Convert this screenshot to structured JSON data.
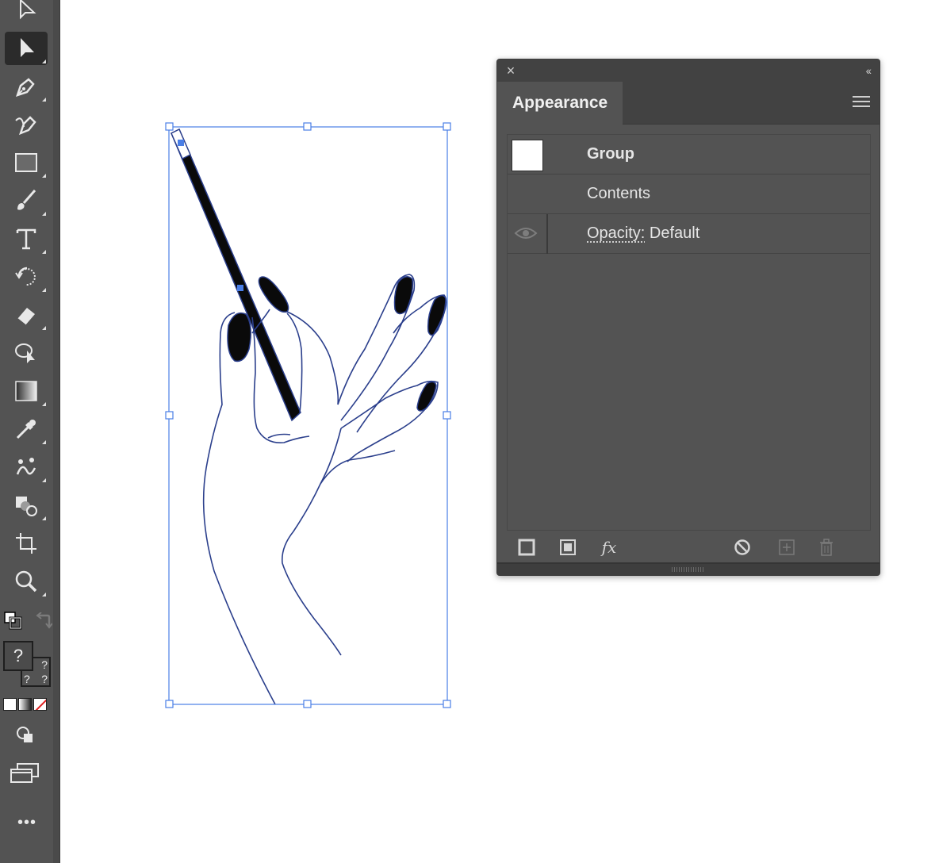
{
  "toolbar": {
    "tools": [
      {
        "name": "selection-tool",
        "icon": "arrow-outline-icon"
      },
      {
        "name": "direct-selection-tool",
        "icon": "arrow-filled-icon",
        "active": true
      },
      {
        "name": "pen-tool",
        "icon": "pen-icon"
      },
      {
        "name": "curvature-tool",
        "icon": "curvature-pen-icon"
      },
      {
        "name": "rectangle-tool",
        "icon": "rectangle-icon"
      },
      {
        "name": "paintbrush-tool",
        "icon": "brush-icon"
      },
      {
        "name": "type-tool",
        "icon": "type-icon"
      },
      {
        "name": "rotate-tool",
        "icon": "rotate-icon"
      },
      {
        "name": "eraser-tool",
        "icon": "eraser-icon"
      },
      {
        "name": "puppet-warp-tool",
        "icon": "lasso-arrow-icon"
      },
      {
        "name": "gradient-tool",
        "icon": "gradient-icon"
      },
      {
        "name": "eyedropper-tool",
        "icon": "eyedropper-icon"
      },
      {
        "name": "blend-tool",
        "icon": "blend-icon"
      },
      {
        "name": "shape-builder-tool",
        "icon": "shapes-icon"
      },
      {
        "name": "artboard-tool",
        "icon": "artboard-icon"
      },
      {
        "name": "zoom-tool",
        "icon": "zoom-icon"
      }
    ],
    "unknown_glyph": "?",
    "more_label": "•••"
  },
  "panel": {
    "tab_label": "Appearance",
    "close_glyph": "×",
    "collapse_glyph": "‹‹",
    "rows": {
      "group_label": "Group",
      "contents_label": "Contents",
      "opacity_link": "Opacity:",
      "opacity_value": "Default"
    },
    "footer": {
      "fx_label": "fx"
    }
  },
  "colors": {
    "toolbar_bg": "#535353",
    "panel_bg": "#535353",
    "selection_blue": "#4a7ee6",
    "artwork_stroke": "#2b3f8c"
  }
}
